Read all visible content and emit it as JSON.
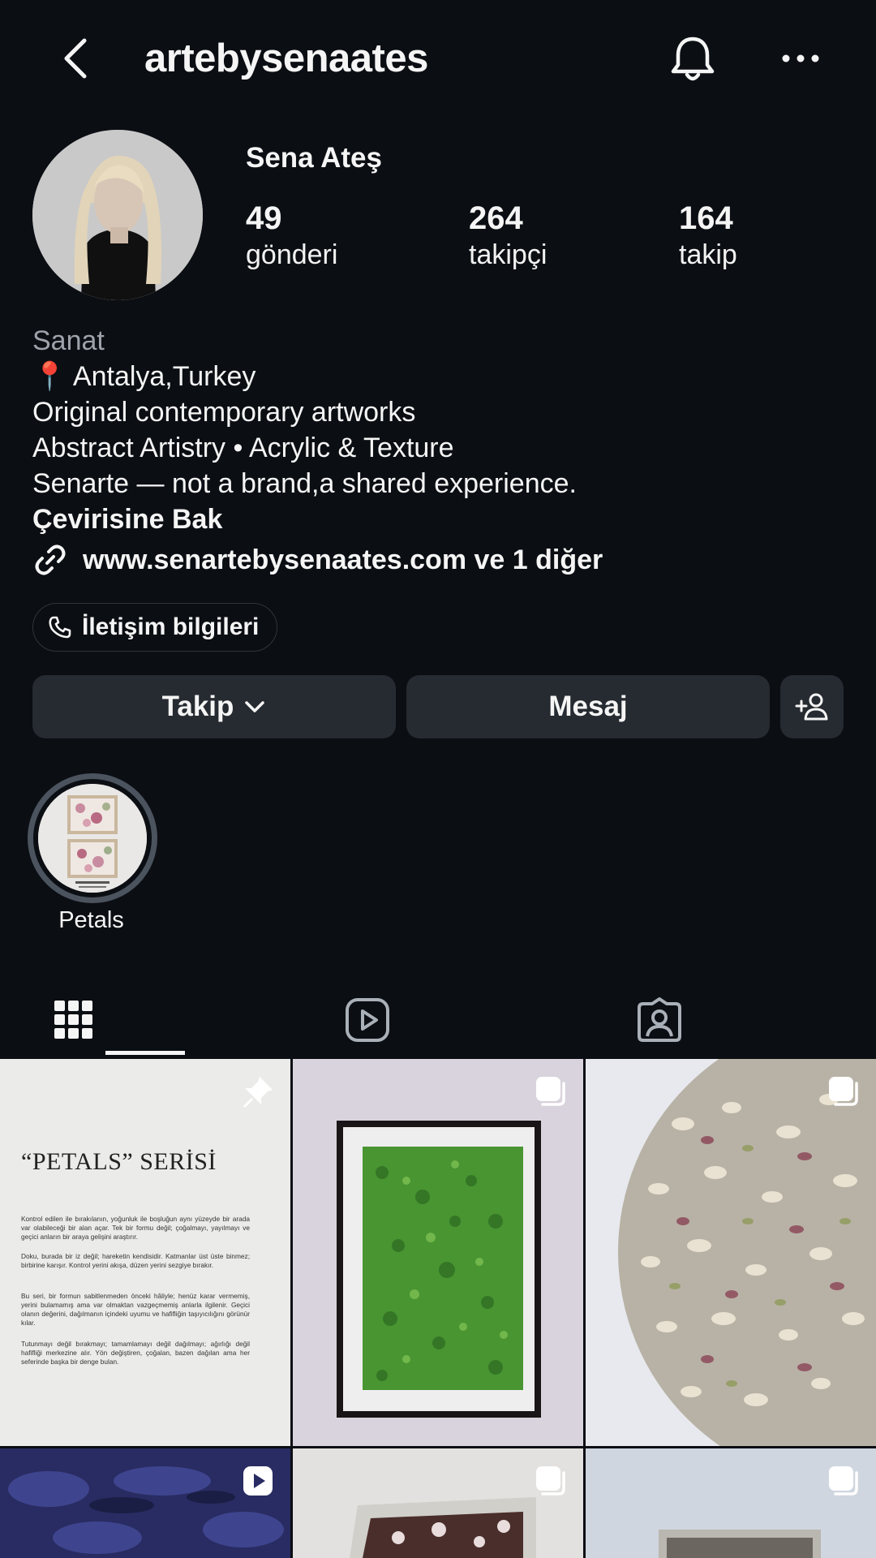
{
  "header": {
    "username": "artebysenaates",
    "back_icon": "chevron-left-icon",
    "bell_icon": "bell-icon",
    "more_icon": "ellipsis-icon"
  },
  "profile": {
    "display_name": "Sena Ateş",
    "stats": [
      {
        "value": "49",
        "label": "gönderi"
      },
      {
        "value": "264",
        "label": "takipçi"
      },
      {
        "value": "164",
        "label": "takip"
      }
    ]
  },
  "bio": {
    "category": "Sanat",
    "location": "📍 Antalya,Turkey",
    "lines": [
      "Original contemporary artworks",
      "Abstract Artistry • Acrylic & Texture",
      "Senarte — not a brand,a shared experience."
    ],
    "translate": "Çevirisine Bak",
    "link": "www.senartebysenaates.com ve 1 diğer"
  },
  "contact": {
    "label": "İletişim bilgileri"
  },
  "buttons": {
    "follow": "Takip",
    "message": "Mesaj"
  },
  "highlights": [
    {
      "label": "Petals"
    }
  ],
  "tabs": [
    "grid-icon",
    "reels-icon",
    "tagged-icon"
  ],
  "posts": {
    "pinned": {
      "title": "“PETALS” SERİSİ",
      "paragraphs": [
        "Kontrol edilen ile bırakılanın, yoğunluk ile boşluğun aynı yüzeyde bir arada var olabileceği bir alan açar. Tek bir formu değil; çoğalmayı, yayılmayı ve geçici anların bir araya gelişini araştırır.",
        "Doku, burada bir iz değil; hareketin kendisidir. Katmanlar üst üste binmez; birbirine karışır. Kontrol yerini akışa, düzen yerini sezgiye bırakır.",
        "Bu seri, bir formun sabitlenmeden önceki hâliyle; henüz karar vermemiş, yerini bulamamış ama var olmaktan vazgeçmemiş anlarla ilgilenir. Geçici olanın değerini, dağılmanın içindeki uyumu ve hafifliğin taşıyıcılığını görünür kılar.",
        "Tutunmayı değil bırakmayı; tamamlamayı değil dağılmayı; ağırlığı değil hafifliği merkezine alır. Yön değiştiren, çoğalan, bazen dağılan ama her seferinde başka bir denge bulan."
      ]
    }
  }
}
